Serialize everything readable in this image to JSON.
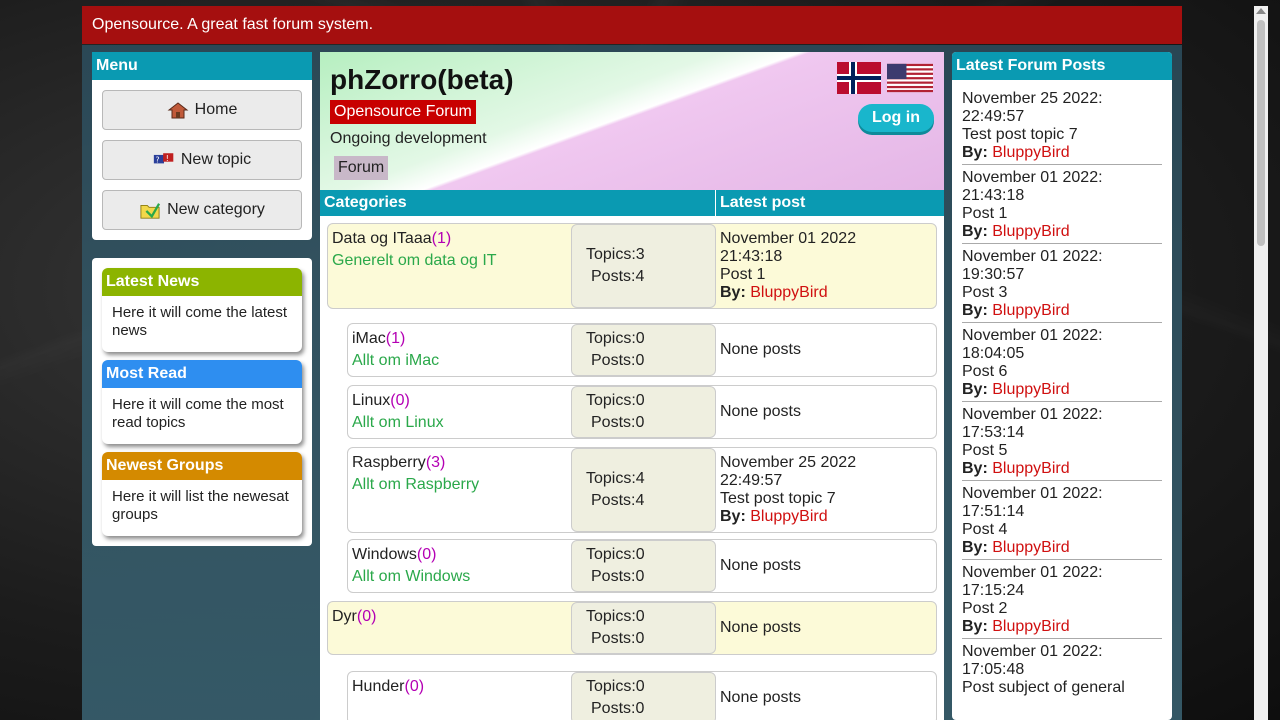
{
  "topbar": {
    "text": "Opensource. A great fast forum system."
  },
  "menu": {
    "title": "Menu",
    "items": [
      {
        "label": "Home",
        "icon": "home-icon"
      },
      {
        "label": "New topic",
        "icon": "new-topic-icon"
      },
      {
        "label": "New category",
        "icon": "folder-icon"
      }
    ]
  },
  "widgets": [
    {
      "title": "Latest News",
      "body": "Here it will come the latest news",
      "color": "#8cb400"
    },
    {
      "title": "Most Read",
      "body": "Here it will come the most read topics",
      "color": "#2e8ef0"
    },
    {
      "title": "Newest Groups",
      "body": "Here it will list the newesat groups",
      "color": "#d48a00"
    }
  ],
  "hero": {
    "title": "phZorro(beta)",
    "badge": "Opensource Forum",
    "subtitle": "Ongoing development",
    "forum": "Forum",
    "login": "Log in"
  },
  "table": {
    "col_categories": "Categories",
    "col_latest": "Latest post",
    "rows": [
      {
        "name": "Data og ITaaa",
        "count": "(1)",
        "desc": "Generelt om data og IT",
        "topics": "Topics:3",
        "posts": "Posts:4",
        "date": "November 01 2022",
        "time": "21:43:18",
        "post": "Post 1",
        "by": "By:",
        "user": "BluppyBird"
      },
      {
        "name": "iMac",
        "count": "(1)",
        "desc": "Allt om iMac",
        "topics": "Topics:0",
        "posts": "Posts:0",
        "none": "None posts"
      },
      {
        "name": "Linux",
        "count": "(0)",
        "desc": "Allt om Linux",
        "topics": "Topics:0",
        "posts": "Posts:0",
        "none": "None posts"
      },
      {
        "name": "Raspberry",
        "count": "(3)",
        "desc": "Allt om Raspberry",
        "topics": "Topics:4",
        "posts": "Posts:4",
        "date": "November 25 2022",
        "time": "22:49:57",
        "post": "Test post topic 7",
        "by": "By:",
        "user": "BluppyBird"
      },
      {
        "name": "Windows",
        "count": "(0)",
        "desc": "Allt om Windows",
        "topics": "Topics:0",
        "posts": "Posts:0",
        "none": "None posts"
      },
      {
        "name": "Dyr",
        "count": "(0)",
        "desc": "",
        "topics": "Topics:0",
        "posts": "Posts:0",
        "none": "None posts"
      },
      {
        "name": "Hunder",
        "count": "(0)",
        "desc": "",
        "topics": "Topics:0",
        "posts": "Posts:0",
        "none": "None posts"
      }
    ]
  },
  "latest": {
    "title": "Latest Forum Posts",
    "posts": [
      {
        "date": "November 25 2022:",
        "time": "22:49:57",
        "title": "Test post topic 7",
        "by": "By:",
        "user": "BluppyBird"
      },
      {
        "date": "November 01 2022:",
        "time": "21:43:18",
        "title": "Post 1",
        "by": "By:",
        "user": "BluppyBird"
      },
      {
        "date": "November 01 2022:",
        "time": "19:30:57",
        "title": "Post 3",
        "by": "By:",
        "user": "BluppyBird"
      },
      {
        "date": "November 01 2022:",
        "time": "18:04:05",
        "title": "Post 6",
        "by": "By:",
        "user": "BluppyBird"
      },
      {
        "date": "November 01 2022:",
        "time": "17:53:14",
        "title": "Post 5",
        "by": "By:",
        "user": "BluppyBird"
      },
      {
        "date": "November 01 2022:",
        "time": "17:51:14",
        "title": "Post 4",
        "by": "By:",
        "user": "BluppyBird"
      },
      {
        "date": "November 01 2022:",
        "time": "17:15:24",
        "title": "Post 2",
        "by": "By:",
        "user": "BluppyBird"
      },
      {
        "date": "November 01 2022:",
        "time": "17:05:48",
        "title": "Post subject of general",
        "by": "",
        "user": ""
      }
    ]
  }
}
